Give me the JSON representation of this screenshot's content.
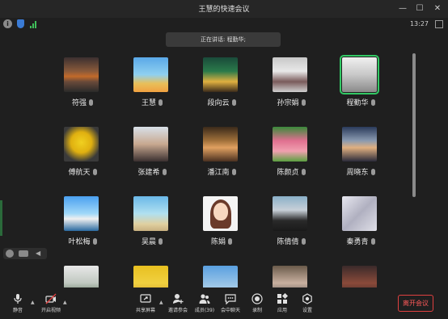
{
  "window": {
    "title": "王慧的快速会议",
    "controls": {
      "minimize": "—",
      "maximize": "☐",
      "close": "✕"
    },
    "time": "13:27"
  },
  "speaking_banner": "正在讲话: 程勤华;",
  "participants": [
    {
      "name": "符强",
      "avatar": "sunset-photo"
    },
    {
      "name": "王慧",
      "avatar": "woman-beach-photo"
    },
    {
      "name": "段向云",
      "avatar": "cave-lights-photo"
    },
    {
      "name": "孙宗娟",
      "avatar": "woman-standing-photo"
    },
    {
      "name": "程勤华",
      "avatar": "building-photo",
      "active_speaker": true
    },
    {
      "name": "傅航天",
      "avatar": "minion-photo"
    },
    {
      "name": "张建希",
      "avatar": "woman-selfie-photo"
    },
    {
      "name": "潘江南",
      "avatar": "lamp-photo"
    },
    {
      "name": "陈颜贞",
      "avatar": "tulips-photo"
    },
    {
      "name": "周晓东",
      "avatar": "coast-photo"
    },
    {
      "name": "叶松梅",
      "avatar": "sky-clouds-photo"
    },
    {
      "name": "吴晨",
      "avatar": "beach-photo"
    },
    {
      "name": "陈娟",
      "avatar": "cartoon-girl"
    },
    {
      "name": "陈倩倩",
      "avatar": "woman-portrait-photo"
    },
    {
      "name": "秦勇青",
      "avatar": "abstract-photo"
    },
    {
      "name": "",
      "avatar": "tree-photo"
    },
    {
      "name": "",
      "avatar": "girl-yellow-photo"
    },
    {
      "name": "",
      "avatar": "sky-tower-photo"
    },
    {
      "name": "",
      "avatar": "group-photo"
    },
    {
      "name": "",
      "avatar": "dark-photo"
    }
  ],
  "toolbar": {
    "mute": "静音",
    "start_video": "开启视频",
    "share_screen": "共享屏幕",
    "invite": "邀请参会",
    "members": "成员(39)",
    "chat": "会中聊天",
    "record": "录制",
    "apps": "应用",
    "settings": "设置",
    "leave": "离开会议"
  },
  "colors": {
    "background": "#1f1f1f",
    "active_speaker_outline": "#32c864",
    "leave_button": "#e04040",
    "signal": "#3fbf5a"
  }
}
